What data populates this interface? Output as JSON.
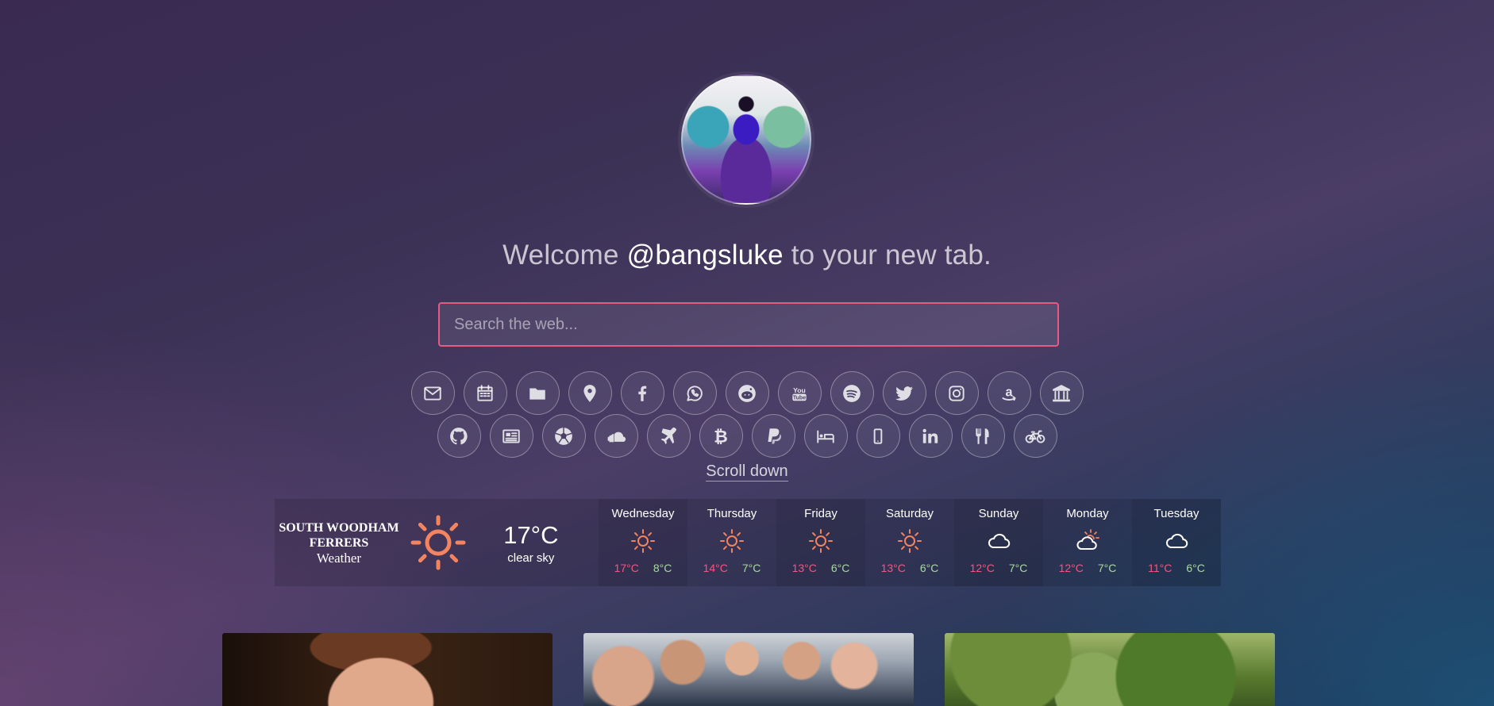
{
  "welcome": {
    "prefix": "Welcome",
    "username": "@bangsluke",
    "suffix": "to your new tab."
  },
  "search": {
    "placeholder": "Search the web..."
  },
  "links_row1": [
    "mail",
    "calendar",
    "folder",
    "map-pin",
    "facebook",
    "whatsapp",
    "reddit",
    "youtube",
    "spotify",
    "twitter",
    "instagram",
    "amazon",
    "bank"
  ],
  "links_row2": [
    "github",
    "newspaper",
    "football",
    "soundcloud",
    "plane",
    "bitcoin",
    "paypal",
    "bed",
    "mobile",
    "linkedin",
    "restaurant",
    "bicycle"
  ],
  "scroll_label": "Scroll down",
  "weather": {
    "city": "SOUTH WOODHAM FERRERS",
    "label": "Weather",
    "current_temp": "17°C",
    "current_desc": "clear sky",
    "current_icon": "sun-icon",
    "days": [
      {
        "name": "Wednesday",
        "icon": "sun-icon",
        "hi": "17°C",
        "lo": "8°C"
      },
      {
        "name": "Thursday",
        "icon": "sun-icon",
        "hi": "14°C",
        "lo": "7°C"
      },
      {
        "name": "Friday",
        "icon": "sun-icon",
        "hi": "13°C",
        "lo": "6°C"
      },
      {
        "name": "Saturday",
        "icon": "sun-icon",
        "hi": "13°C",
        "lo": "6°C"
      },
      {
        "name": "Sunday",
        "icon": "cloud-icon",
        "hi": "12°C",
        "lo": "7°C"
      },
      {
        "name": "Monday",
        "icon": "partly-cloudy-icon",
        "hi": "12°C",
        "lo": "7°C"
      },
      {
        "name": "Tuesday",
        "icon": "cloud-icon",
        "hi": "11°C",
        "lo": "6°C"
      }
    ]
  },
  "colors": {
    "accent": "#e55b83",
    "sun": "#f4845f",
    "hi_temp": "#f2577f",
    "lo_temp": "#a9d9a4"
  }
}
